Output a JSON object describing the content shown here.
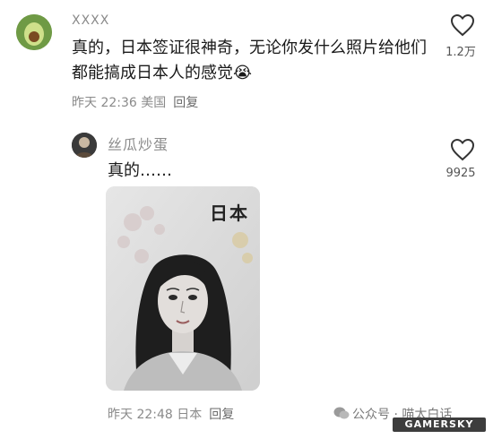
{
  "comments": [
    {
      "user": "XXXX",
      "text": "真的，日本签证很神奇，无论你发什么照片给他们都能搞成日本人的感觉😭",
      "time": "昨天 22:36 美国",
      "reply_label": "回复",
      "likes": "1.2万",
      "avatar_icon": "avocado-icon"
    },
    {
      "user": "丝瓜炒蛋",
      "text": "真的……",
      "time": "昨天 22:48 日本",
      "reply_label": "回复",
      "likes": "9925",
      "image_label": "日本"
    }
  ],
  "watermark": {
    "account": "公众号 · 喵太白话",
    "logo": "GAMERSKY"
  },
  "colors": {
    "avatar_green": "#6f9a45",
    "muted_text": "#8a8a8a",
    "heart_outline": "#333333"
  }
}
